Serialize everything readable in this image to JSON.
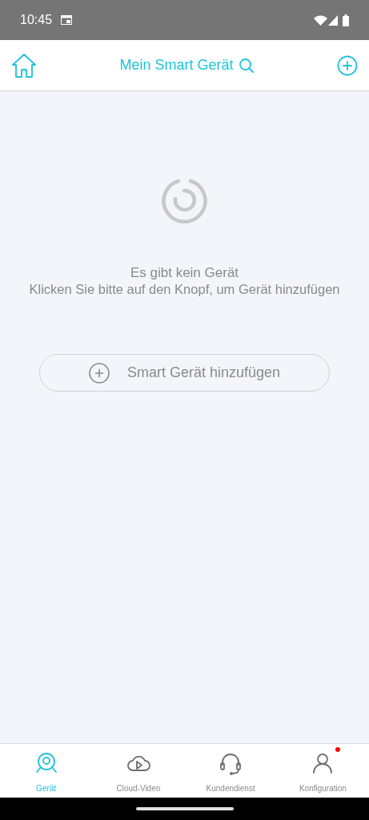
{
  "status_bar": {
    "time": "10:45"
  },
  "header": {
    "title": "Mein Smart Gerät"
  },
  "empty_state": {
    "title": "Es gibt kein Gerät",
    "message": "Klicken Sie bitte auf den Knopf, um Gerät hinzufügen"
  },
  "add_button": {
    "label": "Smart Gerät hinzufügen"
  },
  "tabs": [
    {
      "kind": "camera",
      "label": "Gerät",
      "selected": true,
      "notification": false
    },
    {
      "kind": "cloud",
      "label": "Cloud-Video",
      "selected": false,
      "notification": false
    },
    {
      "kind": "headset",
      "label": "Kundendienst",
      "selected": false,
      "notification": false
    },
    {
      "kind": "person",
      "label": "Konfiguration",
      "selected": false,
      "notification": true
    }
  ]
}
